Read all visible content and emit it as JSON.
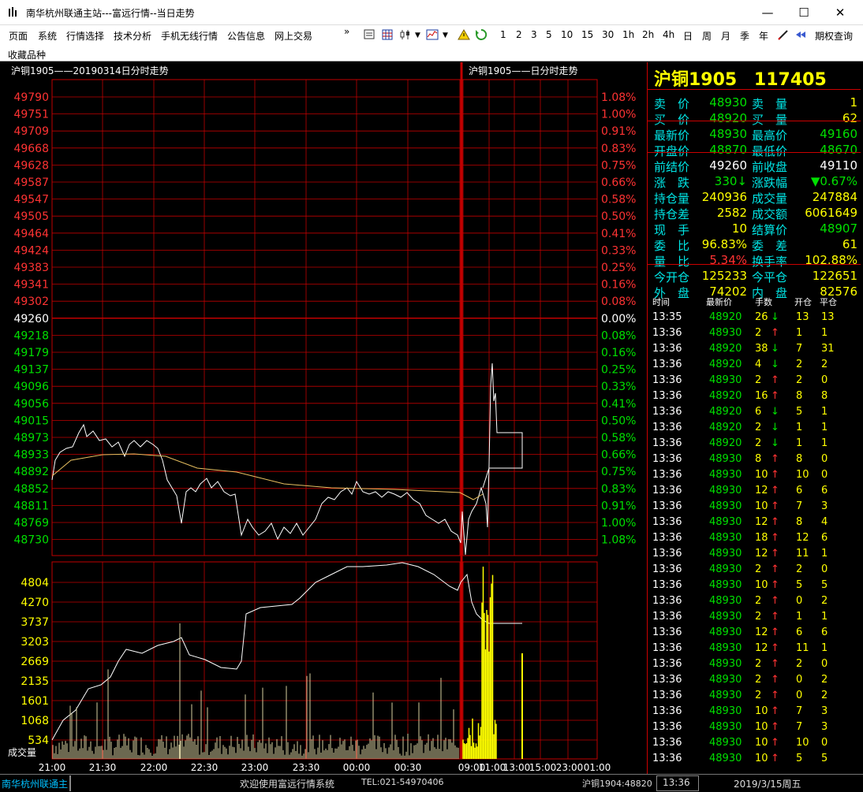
{
  "window": {
    "title": "南华杭州联通主站---富远行情--当日走势",
    "minimize": "—",
    "maximize": "☐",
    "close": "✕"
  },
  "menu": [
    "页面",
    "系统",
    "行情选择",
    "技术分析",
    "手机无线行情",
    "公告信息",
    "网上交易"
  ],
  "menu_more": "»",
  "menu2": "收藏品种",
  "periods": [
    "1",
    "2",
    "3",
    "5",
    "10",
    "15",
    "30",
    "1h",
    "2h",
    "4h",
    "日",
    "周",
    "月",
    "季",
    "年"
  ],
  "rights_query": "期权查询",
  "chart": {
    "left_header": "沪铜1905——20190314日分时走势",
    "right_header": "沪铜1905——日分时走势",
    "price_ticks": [
      "49790",
      "49751",
      "49709",
      "49668",
      "49628",
      "49587",
      "49547",
      "49505",
      "49464",
      "49424",
      "49383",
      "49341",
      "49302",
      "49260",
      "49218",
      "49179",
      "49137",
      "49096",
      "49056",
      "49015",
      "48973",
      "48933",
      "48892",
      "48852",
      "48811",
      "48769",
      "48730"
    ],
    "pct_ticks": [
      "1.08%",
      "1.00%",
      "0.91%",
      "0.83%",
      "0.75%",
      "0.66%",
      "0.58%",
      "0.50%",
      "0.41%",
      "0.33%",
      "0.25%",
      "0.16%",
      "0.08%",
      "0.00%",
      "0.08%",
      "0.16%",
      "0.25%",
      "0.33%",
      "0.41%",
      "0.50%",
      "0.58%",
      "0.66%",
      "0.75%",
      "0.83%",
      "0.91%",
      "1.00%",
      "1.08%"
    ],
    "vol_ticks": [
      "4804",
      "4270",
      "3737",
      "3203",
      "2669",
      "2135",
      "1601",
      "1068",
      "534"
    ],
    "vol_label": "成交量",
    "time_ticks": [
      "21:00",
      "21:30",
      "22:00",
      "22:30",
      "23:00",
      "23:30",
      "00:00",
      "00:30",
      "09:00",
      "11:00",
      "13:00",
      "15:00",
      "23:00",
      "01:00"
    ],
    "colors": {
      "up": "#ff3333",
      "down": "#00e000",
      "flat": "#ffffff",
      "grid": "#c00000",
      "avg": "#e8c060",
      "vol": "#ffff00"
    }
  },
  "quote": {
    "name": "沪铜1905",
    "code": "117405",
    "rows": [
      {
        "l1": "卖　价",
        "v1": "48930",
        "c1": "green",
        "l2": "卖　量",
        "v2": "1",
        "c2": "yellow"
      },
      {
        "l1": "买　价",
        "v1": "48920",
        "c1": "green",
        "l2": "买　量",
        "v2": "62",
        "c2": "yellow"
      },
      {
        "l1": "最新价",
        "v1": "48930",
        "c1": "green",
        "l2": "最高价",
        "v2": "49160",
        "c2": "green"
      },
      {
        "l1": "开盘价",
        "v1": "48870",
        "c1": "green",
        "l2": "最低价",
        "v2": "48670",
        "c2": "green"
      },
      {
        "l1": "前结价",
        "v1": "49260",
        "c1": "white",
        "l2": "前收盘",
        "v2": "49110",
        "c2": "white"
      },
      {
        "l1": "涨　跌",
        "v1": "330↓",
        "c1": "green",
        "l2": "涨跌幅",
        "v2": "▼0.67%",
        "c2": "green"
      },
      {
        "l1": "持仓量",
        "v1": "240936",
        "c1": "yellow",
        "l2": "成交量",
        "v2": "247884",
        "c2": "yellow"
      },
      {
        "l1": "持仓差",
        "v1": "2582",
        "c1": "yellow",
        "l2": "成交额",
        "v2": "6061649",
        "c2": "yellow"
      },
      {
        "l1": "现　手",
        "v1": "10",
        "c1": "yellow",
        "l2": "结算价",
        "v2": "48907",
        "c2": "green"
      },
      {
        "l1": "委　比",
        "v1": "96.83%",
        "c1": "yellow",
        "l2": "委　差",
        "v2": "61",
        "c2": "yellow"
      },
      {
        "l1": "量　比",
        "v1": "5.34%",
        "c1": "red",
        "l2": "换手率",
        "v2": "102.88%",
        "c2": "yellow"
      },
      {
        "l1": "今开仓",
        "v1": "125233",
        "c1": "yellow",
        "l2": "今平仓",
        "v2": "122651",
        "c2": "yellow"
      },
      {
        "l1": "外　盘",
        "v1": "74202",
        "c1": "yellow",
        "l2": "内　盘",
        "v2": "82576",
        "c2": "yellow"
      }
    ],
    "tick_header": [
      "时间",
      "最新价",
      "手数",
      "开仓",
      "平仓"
    ],
    "ticks": [
      {
        "t": "13:35",
        "p": "48920",
        "v": "26",
        "d": "↓",
        "o": "13",
        "c": "13"
      },
      {
        "t": "13:36",
        "p": "48930",
        "v": "2",
        "d": "↑",
        "o": "1",
        "c": "1"
      },
      {
        "t": "13:36",
        "p": "48920",
        "v": "38",
        "d": "↓",
        "o": "7",
        "c": "31"
      },
      {
        "t": "13:36",
        "p": "48920",
        "v": "4",
        "d": "↓",
        "o": "2",
        "c": "2"
      },
      {
        "t": "13:36",
        "p": "48930",
        "v": "2",
        "d": "↑",
        "o": "2",
        "c": "0"
      },
      {
        "t": "13:36",
        "p": "48920",
        "v": "16",
        "d": "↑",
        "o": "8",
        "c": "8"
      },
      {
        "t": "13:36",
        "p": "48920",
        "v": "6",
        "d": "↓",
        "o": "5",
        "c": "1"
      },
      {
        "t": "13:36",
        "p": "48920",
        "v": "2",
        "d": "↓",
        "o": "1",
        "c": "1"
      },
      {
        "t": "13:36",
        "p": "48920",
        "v": "2",
        "d": "↓",
        "o": "1",
        "c": "1"
      },
      {
        "t": "13:36",
        "p": "48930",
        "v": "8",
        "d": "↑",
        "o": "8",
        "c": "0"
      },
      {
        "t": "13:36",
        "p": "48930",
        "v": "10",
        "d": "↑",
        "o": "10",
        "c": "0"
      },
      {
        "t": "13:36",
        "p": "48930",
        "v": "12",
        "d": "↑",
        "o": "6",
        "c": "6"
      },
      {
        "t": "13:36",
        "p": "48930",
        "v": "10",
        "d": "↑",
        "o": "7",
        "c": "3"
      },
      {
        "t": "13:36",
        "p": "48930",
        "v": "12",
        "d": "↑",
        "o": "8",
        "c": "4"
      },
      {
        "t": "13:36",
        "p": "48930",
        "v": "18",
        "d": "↑",
        "o": "12",
        "c": "6"
      },
      {
        "t": "13:36",
        "p": "48930",
        "v": "12",
        "d": "↑",
        "o": "11",
        "c": "1"
      },
      {
        "t": "13:36",
        "p": "48930",
        "v": "2",
        "d": "↑",
        "o": "2",
        "c": "0"
      },
      {
        "t": "13:36",
        "p": "48930",
        "v": "10",
        "d": "↑",
        "o": "5",
        "c": "5"
      },
      {
        "t": "13:36",
        "p": "48930",
        "v": "2",
        "d": "↑",
        "o": "0",
        "c": "2"
      },
      {
        "t": "13:36",
        "p": "48930",
        "v": "2",
        "d": "↑",
        "o": "1",
        "c": "1"
      },
      {
        "t": "13:36",
        "p": "48930",
        "v": "12",
        "d": "↑",
        "o": "6",
        "c": "6"
      },
      {
        "t": "13:36",
        "p": "48930",
        "v": "12",
        "d": "↑",
        "o": "11",
        "c": "1"
      },
      {
        "t": "13:36",
        "p": "48930",
        "v": "2",
        "d": "↑",
        "o": "2",
        "c": "0"
      },
      {
        "t": "13:36",
        "p": "48930",
        "v": "2",
        "d": "↑",
        "o": "0",
        "c": "2"
      },
      {
        "t": "13:36",
        "p": "48930",
        "v": "2",
        "d": "↑",
        "o": "0",
        "c": "2"
      },
      {
        "t": "13:36",
        "p": "48930",
        "v": "10",
        "d": "↑",
        "o": "7",
        "c": "3"
      },
      {
        "t": "13:36",
        "p": "48930",
        "v": "10",
        "d": "↑",
        "o": "7",
        "c": "3"
      },
      {
        "t": "13:36",
        "p": "48930",
        "v": "10",
        "d": "↑",
        "o": "10",
        "c": "0"
      },
      {
        "t": "13:36",
        "p": "48930",
        "v": "10",
        "d": "↑",
        "o": "5",
        "c": "5"
      }
    ]
  },
  "status": {
    "marquee": "南华杭州联通主",
    "welcome": "欢迎使用富远行情系统",
    "tel": "TEL:021-54970406",
    "ticker": "沪铜1904:48820",
    "time": "13:36",
    "date": "2019/3/15周五"
  }
}
